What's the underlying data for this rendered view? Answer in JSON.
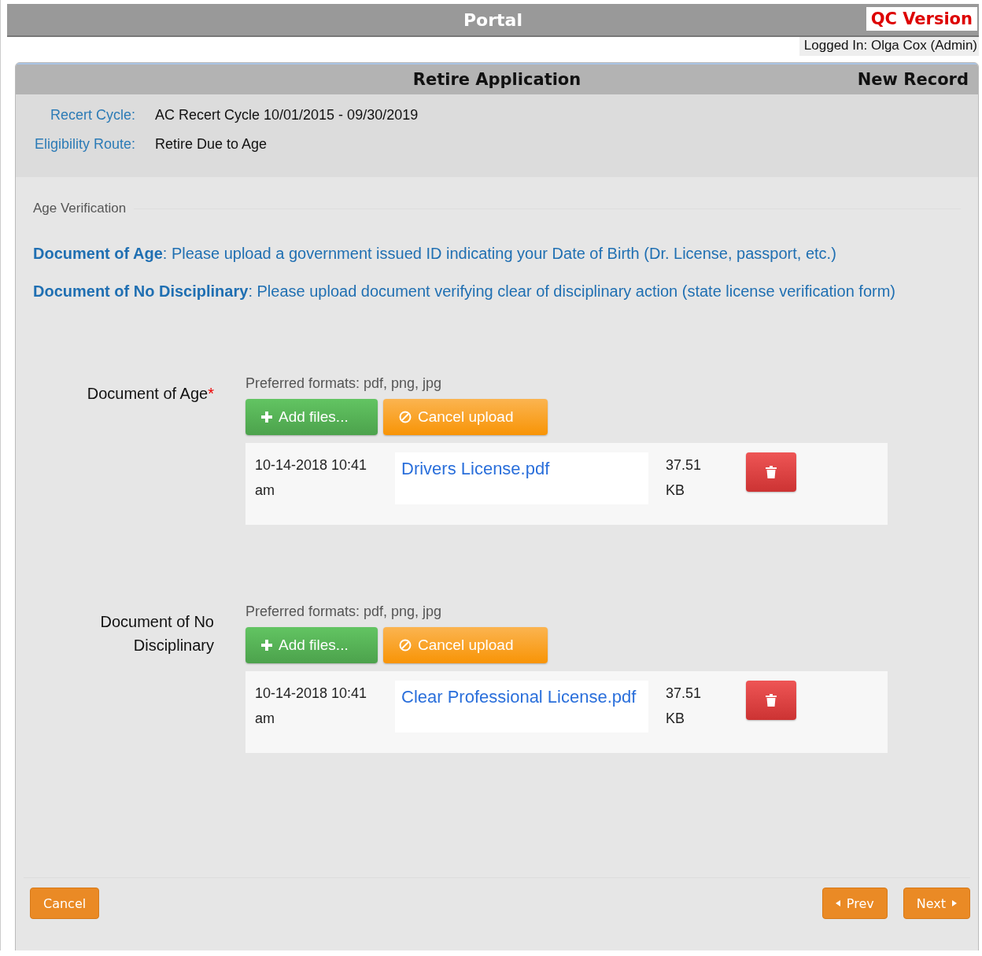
{
  "top_bar": {
    "title": "Portal",
    "badge": "QC Version",
    "logged_in": "Logged In: Olga Cox (Admin)"
  },
  "panel": {
    "title": "Retire Application",
    "status": "New Record",
    "info": [
      {
        "label": "Recert Cycle:",
        "value": "AC Recert Cycle 10/01/2015 - 09/30/2019"
      },
      {
        "label": "Eligibility Route:",
        "value": "Retire Due to Age"
      }
    ],
    "section_title": "Age Verification",
    "instructions": [
      "**Document of Age**: Please upload a government issued ID indicating your Date of Birth (Dr. License, passport, etc.)",
      "**Document of No Disciplinary**: Please upload document verifying clear of disciplinary action (state license verification form)"
    ],
    "uploads": [
      {
        "label": "Document of Age",
        "required_mark": "*",
        "formats": "Preferred formats: pdf, png, jpg",
        "add_button": "Add files...",
        "cancel_button": "Cancel upload",
        "file": {
          "date": "10-14-2018 10:41 am",
          "name": "Drivers License.pdf",
          "size": "37.51 KB"
        }
      },
      {
        "label": "Document of No Disciplinary",
        "formats": "Preferred formats: pdf, png, jpg",
        "add_button": "Add files...",
        "cancel_button": "Cancel upload",
        "file": {
          "date": "10-14-2018 10:41 am",
          "name": "Clear Professional License.pdf",
          "size": "37.51 KB"
        }
      }
    ],
    "footer": {
      "cancel": "Cancel",
      "prev": "Prev",
      "next": "Next"
    }
  }
}
